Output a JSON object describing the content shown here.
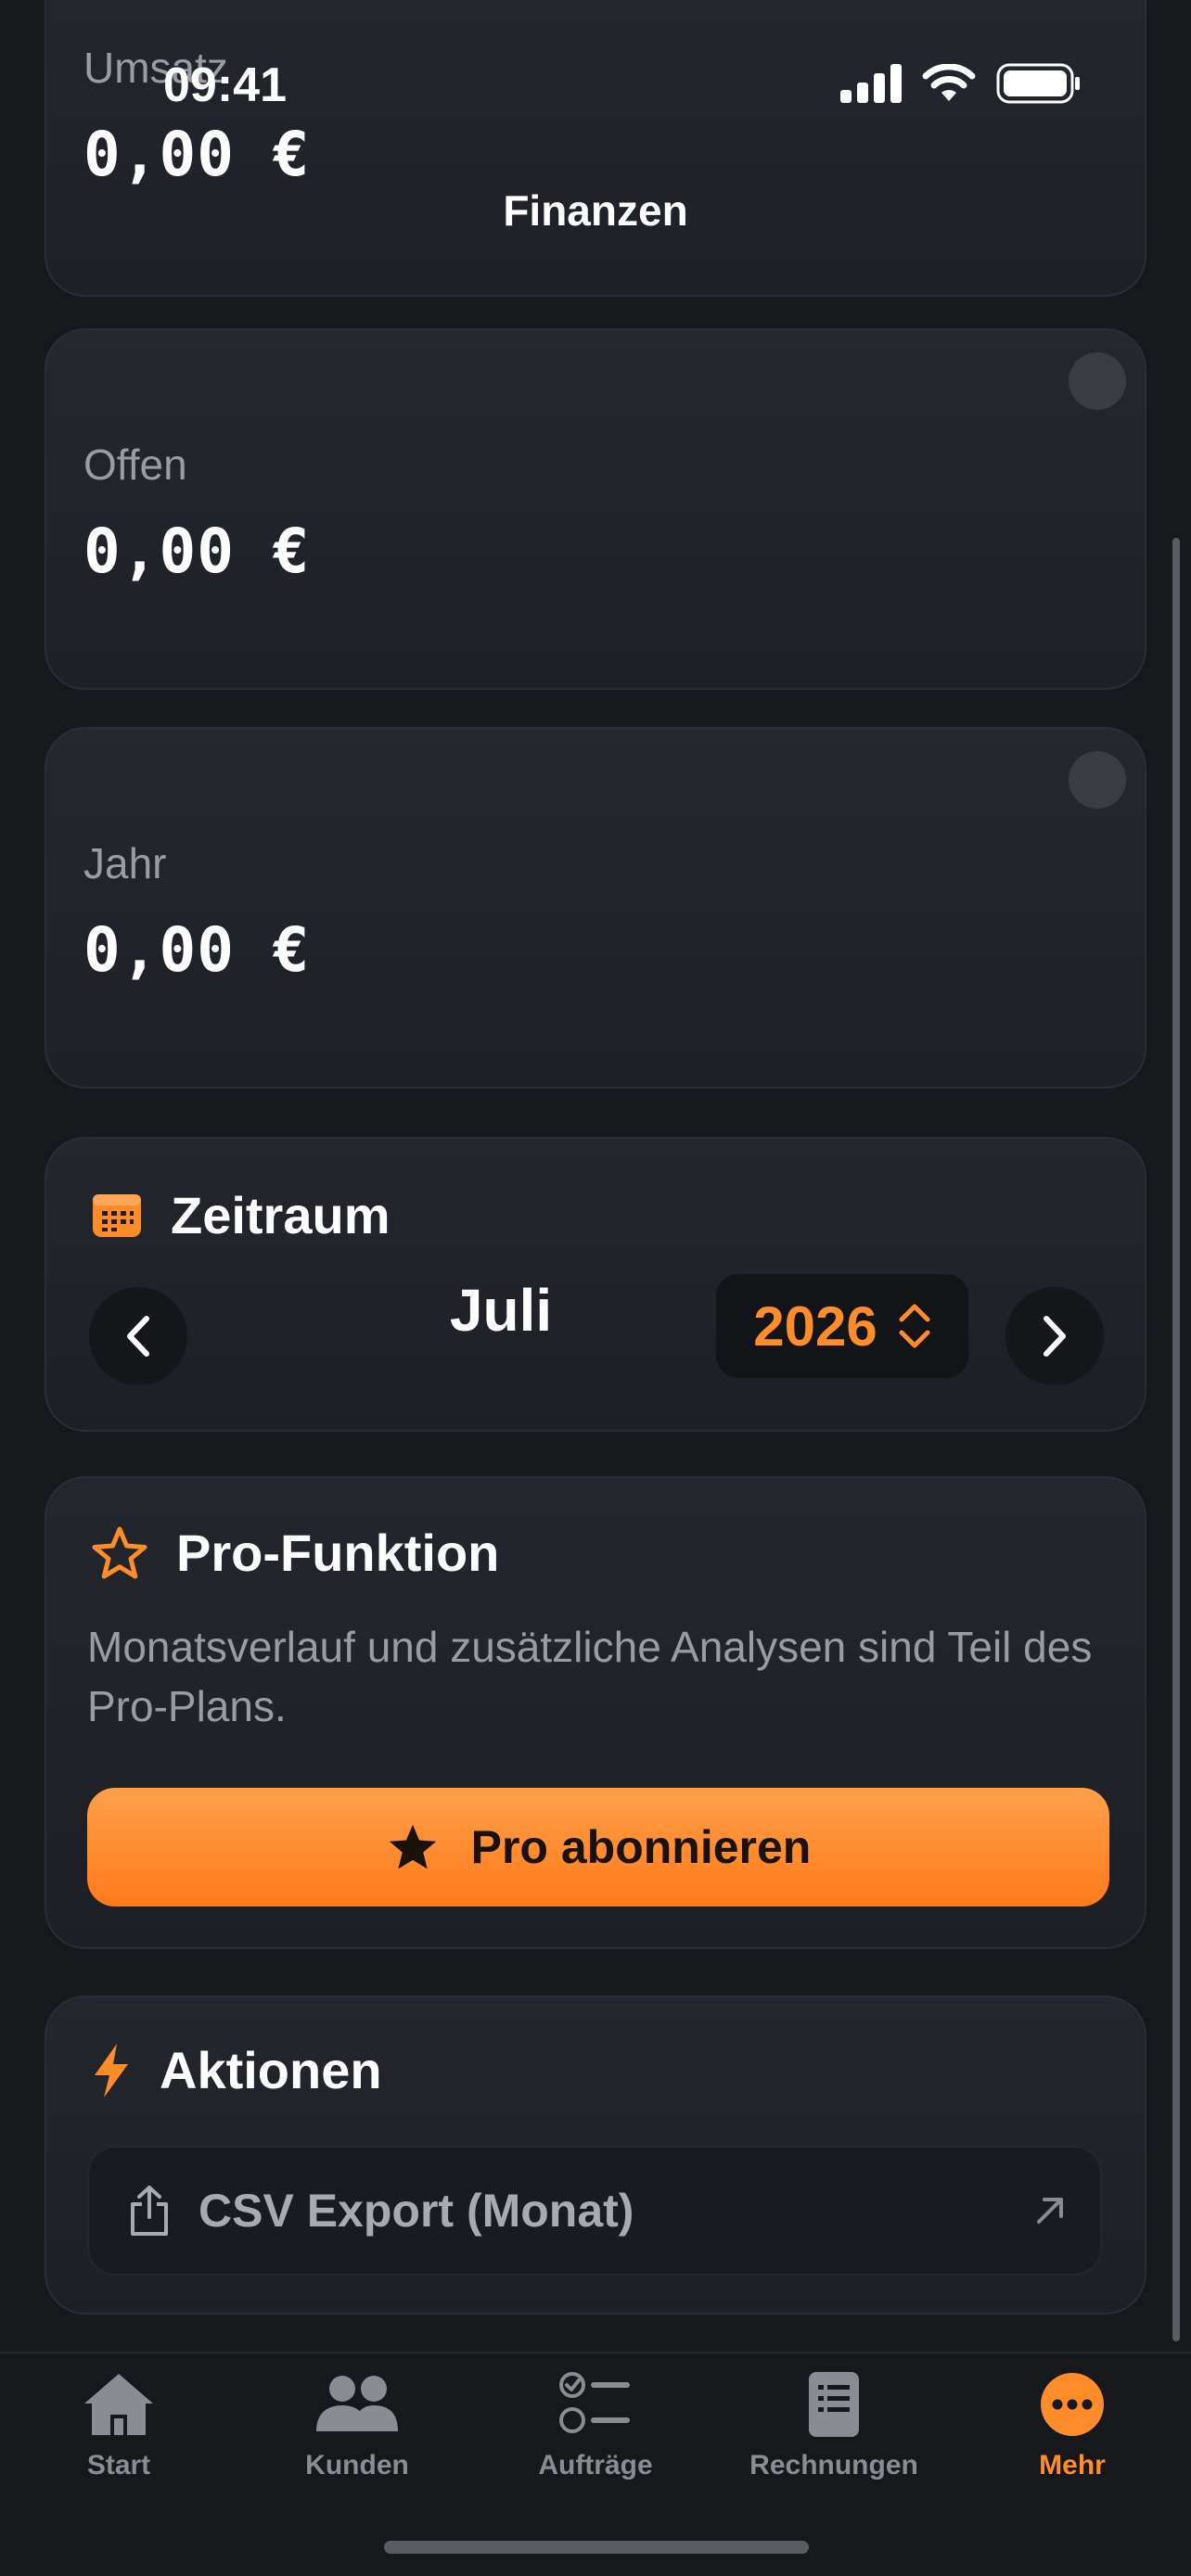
{
  "status_bar": {
    "time": "09:41"
  },
  "nav": {
    "title": "Finanzen"
  },
  "stats": [
    {
      "label": "Umsatz",
      "value": "0,00 €"
    },
    {
      "label": "Offen",
      "value": "0,00 €"
    },
    {
      "label": "Jahr",
      "value": "0,00 €"
    }
  ],
  "period": {
    "title": "Zeitraum",
    "month": "Juli",
    "year": "2026"
  },
  "pro": {
    "title": "Pro-Funktion",
    "description": "Monatsverlauf und zusätzliche Analysen sind Teil des Pro-Plans.",
    "button_label": "Pro abonnieren"
  },
  "actions": {
    "title": "Aktionen",
    "items": [
      {
        "label": "CSV Export (Monat)"
      }
    ]
  },
  "tabbar": {
    "items": [
      {
        "label": "Start",
        "icon": "house-icon"
      },
      {
        "label": "Kunden",
        "icon": "people-icon"
      },
      {
        "label": "Aufträge",
        "icon": "checklist-icon"
      },
      {
        "label": "Rechnungen",
        "icon": "document-icon"
      },
      {
        "label": "Mehr",
        "icon": "more-icon"
      }
    ],
    "active": "Mehr"
  },
  "colors": {
    "accent": "#ff8c2a",
    "background": "#16181c",
    "card": "#23262c"
  }
}
